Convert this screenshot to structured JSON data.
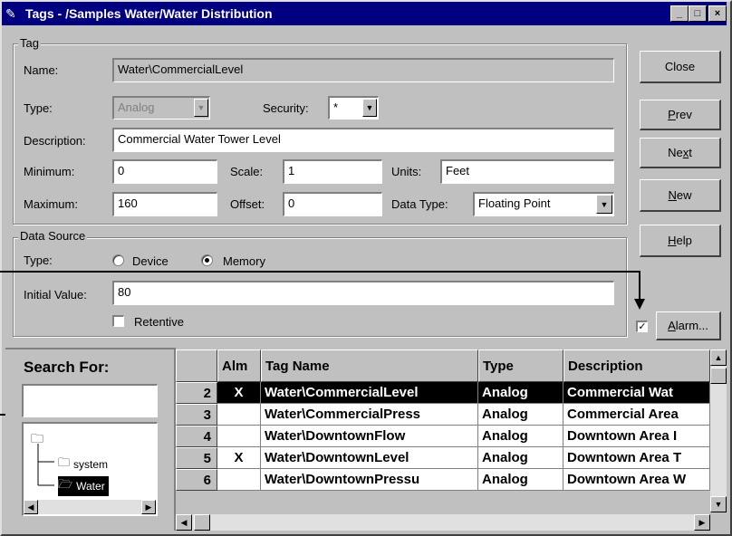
{
  "window": {
    "title": "Tags - /Samples Water/Water Distribution",
    "controls": {
      "minimize": "_",
      "maximize": "□",
      "close": "×"
    }
  },
  "tag_group": {
    "legend": "Tag",
    "name_label": "Name:",
    "name_value": "Water\\CommercialLevel",
    "type_label": "Type:",
    "type_value": "Analog",
    "security_label": "Security:",
    "security_value": "*",
    "description_label": "Description:",
    "description_value": "Commercial Water Tower Level",
    "minimum_label": "Minimum:",
    "minimum_value": "0",
    "scale_label": "Scale:",
    "scale_value": "1",
    "units_label": "Units:",
    "units_value": "Feet",
    "maximum_label": "Maximum:",
    "maximum_value": "160",
    "offset_label": "Offset:",
    "offset_value": "0",
    "datatype_label": "Data Type:",
    "datatype_value": "Floating Point"
  },
  "buttons": {
    "close": "Close",
    "prev_pre": "",
    "prev_u": "P",
    "prev_post": "rev",
    "next_pre": "Ne",
    "next_u": "x",
    "next_post": "t",
    "new_pre": "",
    "new_u": "N",
    "new_post": "ew",
    "help_pre": "",
    "help_u": "H",
    "help_post": "elp",
    "alarm_pre": "",
    "alarm_u": "A",
    "alarm_post": "larm..."
  },
  "data_source": {
    "legend": "Data Source",
    "type_label": "Type:",
    "device_label": "Device",
    "memory_label": "Memory",
    "selected": "Memory",
    "initial_label": "Initial Value:",
    "initial_value": "80",
    "retentive_label": "Retentive",
    "retentive_checked": false,
    "alarm_checked": true,
    "alarm_check_mark": "✓"
  },
  "search": {
    "label": "Search For:",
    "value": ""
  },
  "tree": {
    "root_icon": "folder-open-icon",
    "items": [
      {
        "label": "system",
        "selected": false
      },
      {
        "label": "Water",
        "selected": true
      }
    ]
  },
  "grid": {
    "headers": [
      "",
      "Alm",
      "Tag Name",
      "Type",
      "Description"
    ],
    "rows": [
      {
        "num": "2",
        "alm": "X",
        "name": "Water\\CommercialLevel",
        "type": "Analog",
        "desc": "Commercial Wat",
        "selected": true
      },
      {
        "num": "3",
        "alm": "",
        "name": "Water\\CommercialPress",
        "type": "Analog",
        "desc": "Commercial Area",
        "selected": false
      },
      {
        "num": "4",
        "alm": "",
        "name": "Water\\DowntownFlow",
        "type": "Analog",
        "desc": "Downtown Area I",
        "selected": false
      },
      {
        "num": "5",
        "alm": "X",
        "name": "Water\\DowntownLevel",
        "type": "Analog",
        "desc": "Downtown Area T",
        "selected": false
      },
      {
        "num": "6",
        "alm": "",
        "name": "Water\\DowntownPressu",
        "type": "Analog",
        "desc": "Downtown Area W",
        "selected": false
      }
    ]
  },
  "colors": {
    "titlebar": "#000080",
    "face": "#c0c0c0",
    "selection": "#000000"
  }
}
